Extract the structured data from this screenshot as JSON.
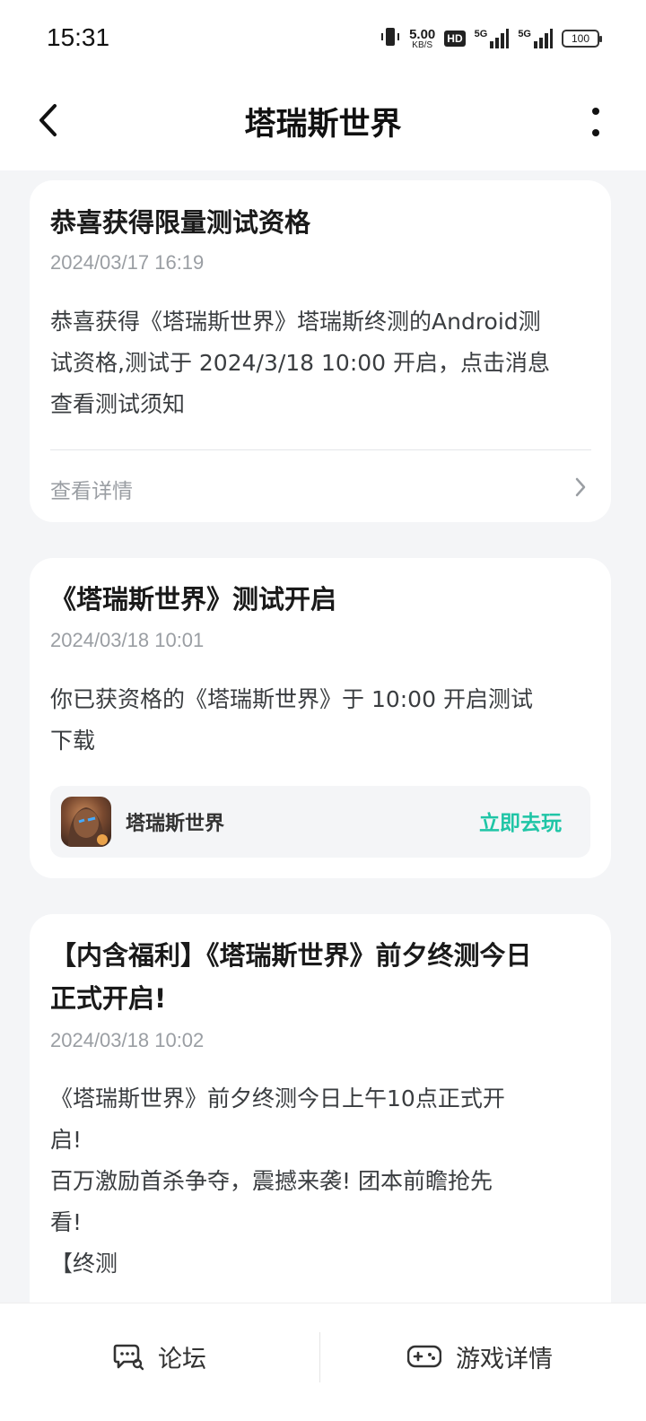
{
  "status_bar": {
    "time": "15:31",
    "net_speed_value": "5.00",
    "net_speed_unit": "KB/S",
    "hd": "HD",
    "signal1": "5G",
    "signal2": "5G",
    "battery": "100"
  },
  "nav": {
    "title": "塔瑞斯世界"
  },
  "cards": [
    {
      "title": "恭喜获得限量测试资格",
      "date": "2024/03/17 16:19",
      "body": "恭喜获得《塔瑞斯世界》塔瑞斯终测的Android测\n试资格,测试于 2024/3/18 10:00 开启，点击消息\n查看测试须知",
      "detail_label": "查看详情"
    },
    {
      "title": "《塔瑞斯世界》测试开启",
      "date": "2024/03/18 10:01",
      "body": "你已获资格的《塔瑞斯世界》于 10:00 开启测试\n下载",
      "game_name": "塔瑞斯世界",
      "play_label": "立即去玩"
    },
    {
      "title_line1": "【内含福利】《塔瑞斯世界》前夕终测今日",
      "title_line2": "正式开启!",
      "date": "2024/03/18 10:02",
      "body": "《塔瑞斯世界》前夕终测今日上午10点正式开\n启!\n百万激励首杀争夺，震撼来袭! 团本前瞻抢先\n看!\n【终测"
    }
  ],
  "bottom_bar": {
    "forum_label": "论坛",
    "game_detail_label": "游戏详情"
  },
  "colors": {
    "accent": "#1fc5a6",
    "background": "#f4f5f7",
    "card": "#ffffff"
  }
}
